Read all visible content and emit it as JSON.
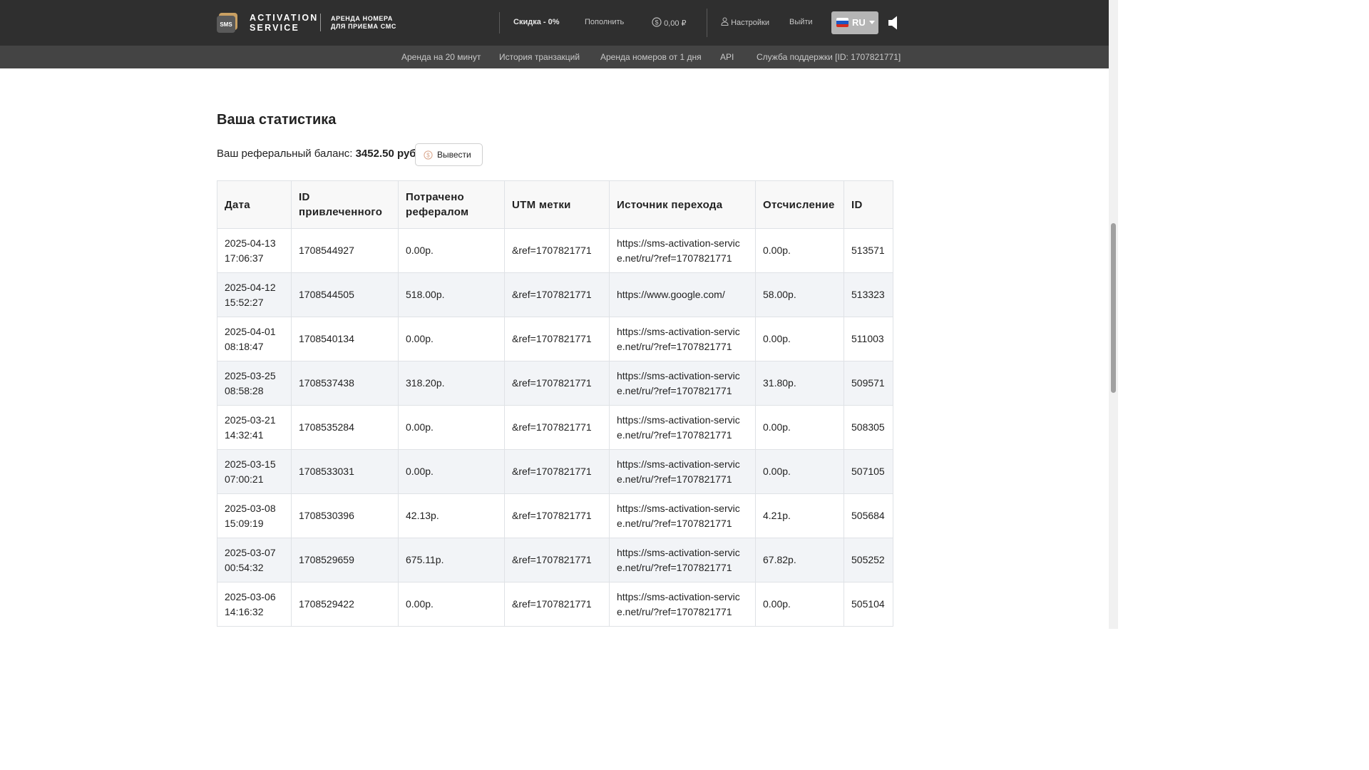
{
  "header": {
    "logo_badge": "SMS",
    "logo_line1": "ACTIVATION",
    "logo_line2": "SERVICE",
    "tagline_line1": "АРЕНДА НОМЕРА",
    "tagline_line2": "ДЛЯ ПРИЕМА СМС",
    "discount": "Скидка - 0%",
    "topup": "Пополнить",
    "balance": "0,00 ₽",
    "settings": "Настройки",
    "logout": "Выйти",
    "language": "RU"
  },
  "subnav": {
    "items": [
      "Аренда на 20 минут",
      "История транзакций",
      "Аренда номеров от 1 дня",
      "API",
      "Служба поддержки [ID: 1707821771]"
    ]
  },
  "main": {
    "title": "Ваша статистика",
    "balance_label": "Ваш реферальный баланс:",
    "balance_value": "3452.50 руб.",
    "withdraw_label": "Вывести"
  },
  "table": {
    "headers": [
      "Дата",
      "ID привлеченного",
      "Потрачено рефералом",
      "UTM метки",
      "Источник перехода",
      "Отсчисление",
      "ID"
    ],
    "rows": [
      [
        "2025-04-13 17:06:37",
        "1708544927",
        "0.00р.",
        "&ref=1707821771",
        "https://sms-activation-service.net/ru/?ref=1707821771",
        "0.00р.",
        "513571"
      ],
      [
        "2025-04-12 15:52:27",
        "1708544505",
        "518.00р.",
        "&ref=1707821771",
        "https://www.google.com/",
        "58.00р.",
        "513323"
      ],
      [
        "2025-04-01 08:18:47",
        "1708540134",
        "0.00р.",
        "&ref=1707821771",
        "https://sms-activation-service.net/ru/?ref=1707821771",
        "0.00р.",
        "511003"
      ],
      [
        "2025-03-25 08:58:28",
        "1708537438",
        "318.20р.",
        "&ref=1707821771",
        "https://sms-activation-service.net/ru/?ref=1707821771",
        "31.80р.",
        "509571"
      ],
      [
        "2025-03-21 14:32:41",
        "1708535284",
        "0.00р.",
        "&ref=1707821771",
        "https://sms-activation-service.net/ru/?ref=1707821771",
        "0.00р.",
        "508305"
      ],
      [
        "2025-03-15 07:00:21",
        "1708533031",
        "0.00р.",
        "&ref=1707821771",
        "https://sms-activation-service.net/ru/?ref=1707821771",
        "0.00р.",
        "507105"
      ],
      [
        "2025-03-08 15:09:19",
        "1708530396",
        "42.13р.",
        "&ref=1707821771",
        "https://sms-activation-service.net/ru/?ref=1707821771",
        "4.21р.",
        "505684"
      ],
      [
        "2025-03-07 00:54:32",
        "1708529659",
        "675.11р.",
        "&ref=1707821771",
        "https://sms-activation-service.net/ru/?ref=1707821771",
        "67.82р.",
        "505252"
      ],
      [
        "2025-03-06 14:16:32",
        "1708529422",
        "0.00р.",
        "&ref=1707821771",
        "https://sms-activation-service.net/ru/?ref=1707821771",
        "0.00р.",
        "505104"
      ]
    ]
  },
  "colors": {
    "topbar": "#2f2f2f",
    "subnav": "#444444",
    "language_button": "#b5b5b5",
    "logo_accent": "#c9a063",
    "row_alt": "#f2f4f7"
  },
  "icons": {
    "balance": "coin-icon",
    "settings": "user-icon",
    "language": "russia-flag-icon",
    "sound": "speaker-icon",
    "withdraw": "coin-icon"
  }
}
